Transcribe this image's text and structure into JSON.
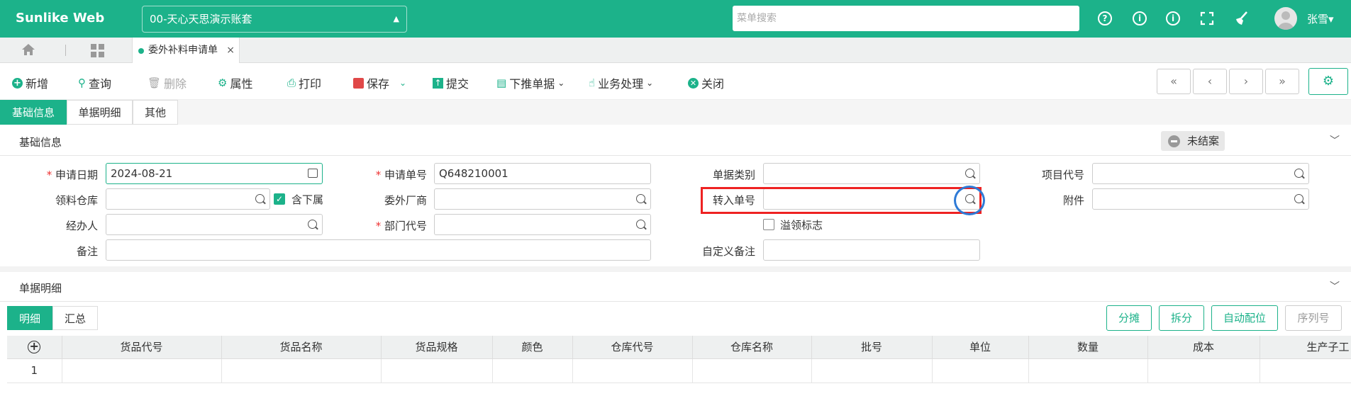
{
  "app": {
    "title": "Sunlike Web",
    "account": "00-天心天思演示账套",
    "search_placeholder": "菜单搜索",
    "user": "张雪▾"
  },
  "tabs": {
    "doc_tab": "委外补料申请单",
    "close": "×"
  },
  "toolbar": {
    "new": "新增",
    "query": "查询",
    "delete": "删除",
    "props": "属性",
    "print": "打印",
    "save": "保存",
    "submit": "提交",
    "push_down": "下推单据",
    "business": "业务处理",
    "close": "关闭",
    "first": "«",
    "prev": "‹",
    "next": "›",
    "last": "»"
  },
  "subtabs": [
    "基础信息",
    "单据明细",
    "其他"
  ],
  "basic": {
    "section_title": "基础信息",
    "status": "未结案",
    "apply_date_label": "申请日期",
    "apply_date": "2024-08-21",
    "apply_no_label": "申请单号",
    "apply_no": "Q648210001",
    "doc_type_label": "单据类别",
    "project_label": "项目代号",
    "warehouse_label": "领料仓库",
    "include_sub": "含下属",
    "vendor_label": "委外厂商",
    "transfer_no_label": "转入单号",
    "attach_label": "附件",
    "handler_label": "经办人",
    "dept_label": "部门代号",
    "overflow_flag": "溢领标志",
    "remark_label": "备注",
    "custom_remark_label": "自定义备注"
  },
  "detail": {
    "section_title": "单据明细",
    "tabs": [
      "明细",
      "汇总"
    ],
    "buttons": [
      "分摊",
      "拆分",
      "自动配位",
      "序列号"
    ],
    "columns": [
      "货品代号",
      "货品名称",
      "货品规格",
      "颜色",
      "仓库代号",
      "仓库名称",
      "批号",
      "单位",
      "数量",
      "成本",
      "生产子工"
    ],
    "rows": [
      {
        "no": "1"
      }
    ]
  },
  "colors": {
    "brand": "#1cb28a",
    "highlight_box": "#e22222",
    "highlight_ring": "#2e7ad6"
  },
  "icons": [
    "home-icon",
    "grid-icon",
    "help-icon",
    "info-icon",
    "info-icon",
    "fullscreen-icon",
    "broom-icon",
    "settings-icon",
    "search-icon",
    "calendar-icon"
  ]
}
